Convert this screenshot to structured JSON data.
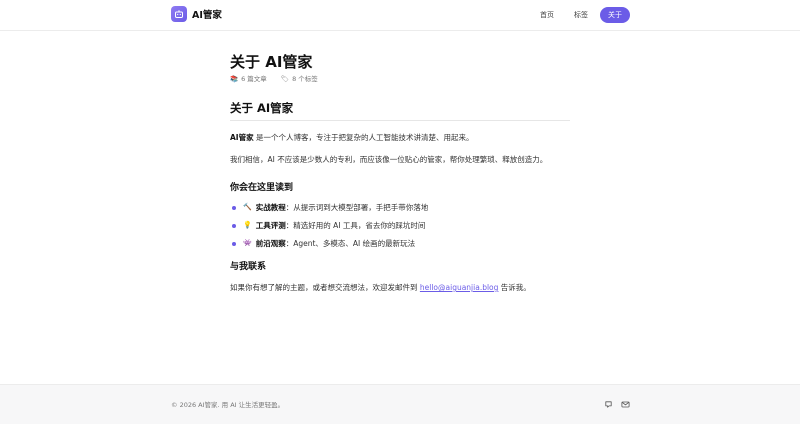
{
  "header": {
    "brand_name": "AI管家",
    "logo_icon": "robot-icon",
    "nav": [
      {
        "label": "首页",
        "active": false
      },
      {
        "label": "标签",
        "active": false
      },
      {
        "label": "关于",
        "active": true
      }
    ]
  },
  "page": {
    "title": "关于 AI管家",
    "meta": {
      "posts_emoji": "📚",
      "posts": "6 篇文章",
      "tags_emoji": "🏷",
      "tags": "8 个标签"
    }
  },
  "content": {
    "h2": "关于 AI管家",
    "intro_strong": "AI管家",
    "intro_rest": " 是一个个人博客，专注于把复杂的人工智能技术讲清楚、用起来。",
    "belief": "我们相信，AI 不应该是少数人的专利，而应该像一位贴心的管家，帮你处理繁琐、释放创造力。",
    "read_heading": "你会在这里读到",
    "items": [
      {
        "emoji": "🔨",
        "strong": "实战教程",
        "text": "：从提示词到大模型部署，手把手带你落地"
      },
      {
        "emoji": "💡",
        "strong": "工具评测",
        "text": "：精选好用的 AI 工具，省去你的踩坑时间"
      },
      {
        "emoji": "👾",
        "strong": "前沿观察",
        "text": "：Agent、多模态、AI 绘画的最新玩法"
      }
    ],
    "contact_heading": "与我联系",
    "contact_before": "如果你有想了解的主题，或者想交流想法，欢迎发邮件到 ",
    "contact_email": "hello@aiguanjia.blog",
    "contact_after": " 告诉我。"
  },
  "footer": {
    "copyright": "© 2026 AI管家. 用 AI 让生活更轻盈。",
    "icons": [
      "github-icon",
      "mail-icon"
    ]
  },
  "colors": {
    "accent": "#6b5ce7",
    "footer_bg": "#f7f7f8"
  }
}
